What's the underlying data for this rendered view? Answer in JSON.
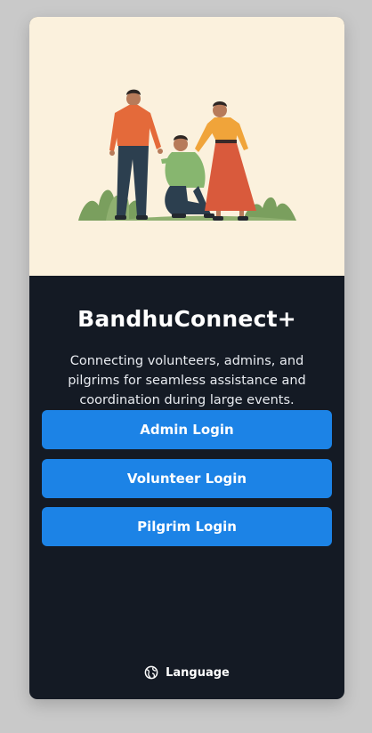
{
  "app": {
    "title": "BandhuConnect+",
    "tagline": "Connecting volunteers, admins, and pilgrims for seamless assistance and coordination during large events."
  },
  "hero": {
    "illustration": "people-helping-illustration"
  },
  "buttons": {
    "admin": "Admin Login",
    "volunteer": "Volunteer Login",
    "pilgrim": "Pilgrim Login"
  },
  "language": {
    "label": "Language",
    "icon": "globe-icon"
  },
  "colors": {
    "card_bg": "#141a24",
    "hero_bg": "#fbf1dd",
    "button_bg": "#1c83e6",
    "page_bg": "#c9c9c9"
  }
}
